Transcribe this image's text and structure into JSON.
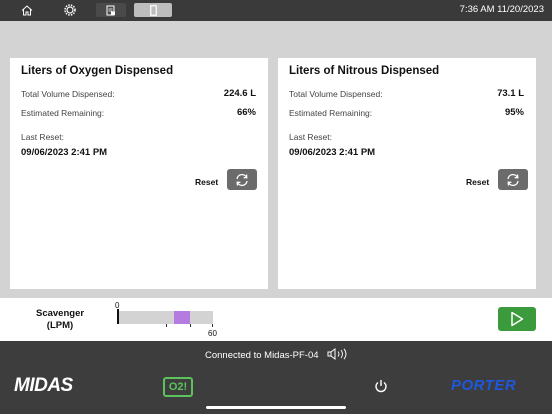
{
  "topbar": {
    "clock": "7:36 AM 11/20/2023",
    "icons": [
      "home-icon",
      "gear-icon",
      "document-icon",
      "tablet-icon"
    ]
  },
  "oxygen_card": {
    "title": "Liters of Oxygen Dispensed",
    "total_label": "Total Volume Dispensed:",
    "total_value": "224.6 L",
    "remaining_label": "Estimated Remaining:",
    "remaining_value": "66%",
    "last_reset_label": "Last Reset:",
    "last_reset_value": "09/06/2023 2:41 PM",
    "reset_label": "Reset"
  },
  "nitrous_card": {
    "title": "Liters of Nitrous Dispensed",
    "total_label": "Total Volume Dispensed:",
    "total_value": "73.1 L",
    "remaining_label": "Estimated Remaining:",
    "remaining_value": "95%",
    "last_reset_label": "Last Reset:",
    "last_reset_value": "09/06/2023 2:41 PM",
    "reset_label": "Reset"
  },
  "scavenger": {
    "label_line1": "Scavenger",
    "label_line2": "(LPM)",
    "min": "0",
    "max": "60",
    "range_low": 34,
    "range_high": 45,
    "fill_color": "#b57be0"
  },
  "bottombar": {
    "connection": "Connected to Midas-PF-04",
    "brand_left": "MIDAS",
    "o2_badge": "O2!",
    "brand_right": "PORTER",
    "accent_green": "#3b9a3b",
    "accent_blue": "#1e57e0"
  }
}
